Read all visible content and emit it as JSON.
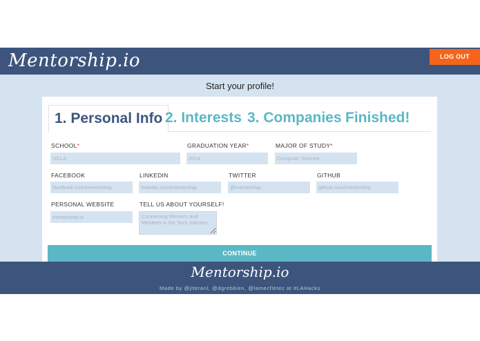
{
  "header": {
    "logo": "Mentorship.io",
    "logout_label": "LOG OUT"
  },
  "main": {
    "title": "Start your profile!"
  },
  "tabs": [
    {
      "label": "1. Personal Info",
      "active": true
    },
    {
      "label": "2. Interests",
      "active": false
    },
    {
      "label": "3. Companies",
      "active": false
    },
    {
      "label": "Finished!",
      "active": false
    }
  ],
  "form": {
    "school": {
      "label": "SCHOOL",
      "required": "*",
      "placeholder": "UCLA"
    },
    "graduation_year": {
      "label": "GRADUATION YEAR",
      "required": "*",
      "placeholder": "2014"
    },
    "major": {
      "label": "MAJOR OF STUDY",
      "required": "*",
      "placeholder": "Computer Science"
    },
    "facebook": {
      "label": "FACEBOOK",
      "placeholder": "facebook.com/mentorship"
    },
    "linkedin": {
      "label": "LINKEDIN",
      "placeholder": "linkedin.com/mentorship"
    },
    "twitter": {
      "label": "TWITTER",
      "placeholder": "@mentorship"
    },
    "github": {
      "label": "GITHUB",
      "placeholder": "github.com/mentorship"
    },
    "website": {
      "label": "PERSONAL WEBSITE",
      "placeholder": "mentorship.io"
    },
    "about": {
      "label": "TELL US ABOUT YOURSELF!",
      "placeholder": "Connecting Mentors and Mentees in the Tech Industry"
    },
    "continue_label": "CONTINUE"
  },
  "footer": {
    "logo": "Mentorship.io",
    "credits": "Made by @jlteranl, @dgrebbien, @lamecfletez at #LAHacks"
  },
  "colors": {
    "navy": "#3d557d",
    "teal": "#5cb7c4",
    "orange": "#f6641a",
    "light_blue": "#d5e3f1"
  }
}
